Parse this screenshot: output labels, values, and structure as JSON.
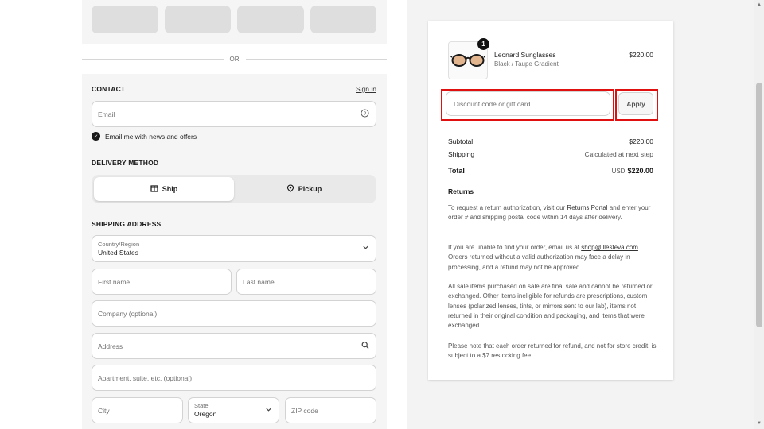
{
  "express_pay": {
    "buttons": [
      "",
      "",
      "",
      ""
    ]
  },
  "separator": {
    "or_text": "OR"
  },
  "contact": {
    "title": "CONTACT",
    "sign_in": "Sign in",
    "email_placeholder": "Email",
    "newsletter_label": "Email me with news and offers",
    "newsletter_checked": true
  },
  "delivery": {
    "title": "DELIVERY METHOD",
    "options": [
      {
        "label": "Ship",
        "icon": "box-icon",
        "active": true
      },
      {
        "label": "Pickup",
        "icon": "location-pin-icon",
        "active": false
      }
    ]
  },
  "shipping": {
    "title": "SHIPPING ADDRESS",
    "country_label": "Country/Region",
    "country_value": "United States",
    "first_name": "First name",
    "last_name": "Last name",
    "company": "Company (optional)",
    "address": "Address",
    "apartment": "Apartment, suite, etc. (optional)",
    "city": "City",
    "state_label": "State",
    "state_value": "Oregon",
    "zip": "ZIP code"
  },
  "order": {
    "item": {
      "quantity": "1",
      "name": "Leonard Sunglasses",
      "variant": "Black / Taupe Gradient",
      "price": "$220.00"
    },
    "discount_placeholder": "Discount code or gift card",
    "apply_label": "Apply",
    "subtotal_label": "Subtotal",
    "subtotal_value": "$220.00",
    "shipping_label": "Shipping",
    "shipping_value": "Calculated at next step",
    "total_label": "Total",
    "total_currency": "USD",
    "total_value": "$220.00"
  },
  "returns": {
    "title": "Returns",
    "p1_a": "To request a return authorization, visit our ",
    "p1_link": "Returns Portal",
    "p1_b": " and enter your order # and shipping postal code within 14 days after delivery.",
    "p2_a": "If you are unable to find your order, email us at ",
    "p2_link": "shop@illesteva.com",
    "p2_b": ". Orders returned without a valid authorization may face a delay in processing, and a refund may not be approved.",
    "p3": "All sale items purchased on sale are final sale and cannot be returned or exchanged. Other items ineligible for refunds are prescriptions, custom lenses (polarized lenses, tints, or mirrors sent to our lab), items not returned in their original condition and packaging, and items that were exchanged.",
    "p4": "Please note that each order returned for refund, and not for store credit, is subject to a $7 restocking fee."
  },
  "colors": {
    "highlight": "#e01010",
    "text": "#1a1a1a",
    "muted": "#707070"
  }
}
